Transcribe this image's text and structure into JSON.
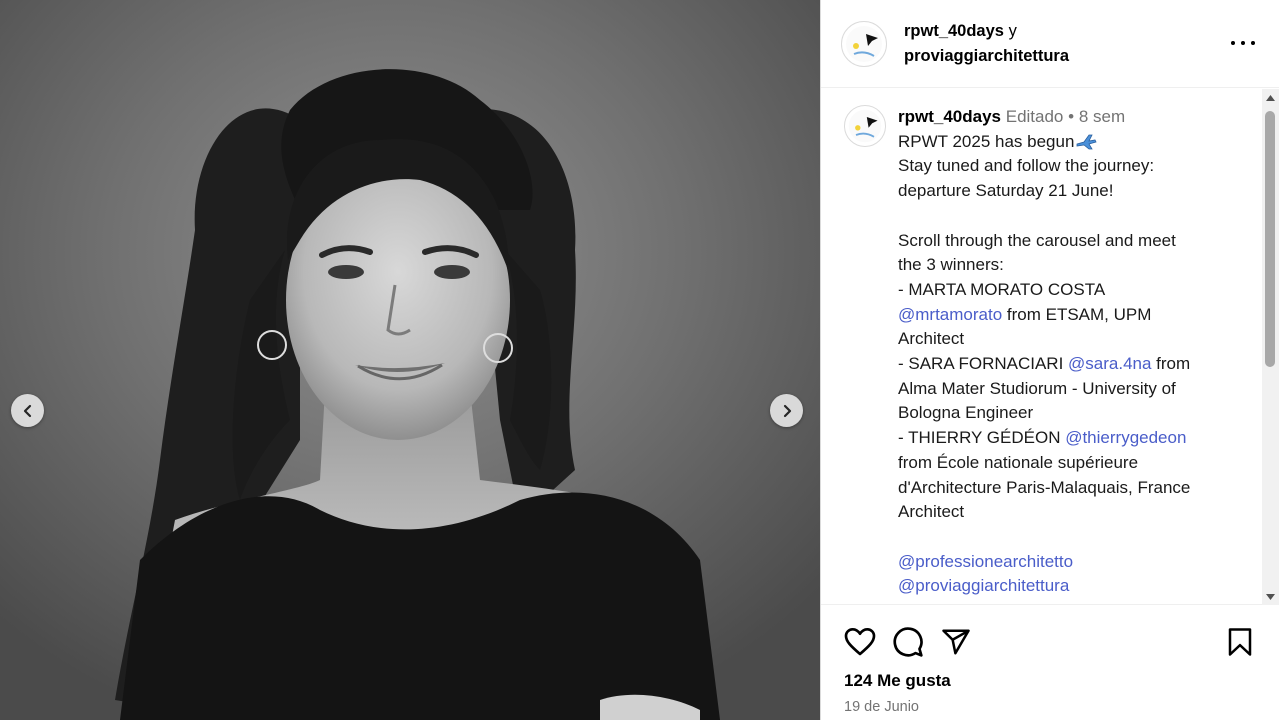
{
  "media": {
    "prev_icon": "chevron-left-icon",
    "next_icon": "chevron-right-icon"
  },
  "header": {
    "user": "rpwt_40days",
    "conjunction": "y",
    "collaborator": "proviaggiarchitettura",
    "more_icon": "more-horizontal-icon"
  },
  "caption": {
    "user": "rpwt_40days",
    "edited": "Editado",
    "separator": "•",
    "time": "8 sem",
    "title": "RPWT 2025 has begun",
    "title_icon": "airplane-emoji",
    "line_2": "Stay tuned and follow the journey:",
    "line_3": "departure Saturday 21 June!",
    "line_4": "Scroll through the carousel and meet",
    "line_5": "the 3 winners:",
    "winner_1_name": "- MARTA MORATO COSTA",
    "winner_1_handle": "@mrtamorato",
    "winner_1_from": " from ETSAM, UPM",
    "winner_1_role": "Architect",
    "winner_2_name": "- SARA FORNACIARI ",
    "winner_2_handle": "@sara.4na",
    "winner_2_from": " from",
    "winner_2_school_1": "Alma Mater Studiorum - University of",
    "winner_2_school_2": "Bologna Engineer",
    "winner_3_name": "- THIERRY GÉDÉON ",
    "winner_3_handle": "@thierrygedeon",
    "winner_3_school_1": "from École nationale supérieure",
    "winner_3_school_2": "d'Architecture Paris-Malaquais, France",
    "winner_3_role": "Architect",
    "tag_1": "@professionearchitetto",
    "tag_2": "@proviaggiarchitettura"
  },
  "actions": {
    "like_icon": "heart-icon",
    "comment_icon": "comment-icon",
    "share_icon": "send-icon",
    "save_icon": "bookmark-icon"
  },
  "stats": {
    "likes": "124 Me gusta",
    "date": "19 de Junio"
  },
  "colors": {
    "link": "#4a5dc9",
    "meta": "#737373"
  }
}
